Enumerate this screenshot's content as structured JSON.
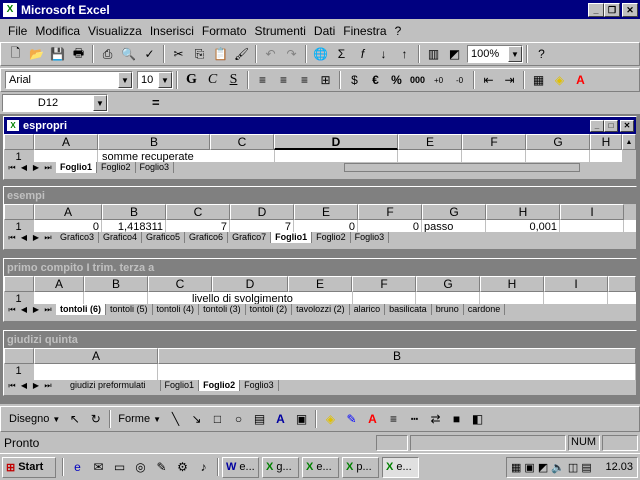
{
  "app": {
    "title": "Microsoft Excel"
  },
  "menu": [
    "File",
    "Modifica",
    "Visualizza",
    "Inserisci",
    "Formato",
    "Strumenti",
    "Dati",
    "Finestra",
    "?"
  ],
  "toolbar": {
    "zoom": "100%",
    "font": "Arial",
    "size": "10",
    "bold": "G",
    "italic": "C",
    "underline": "S",
    "currency": "€",
    "percent": "%",
    "thousands": "000"
  },
  "formula": {
    "namebox": "D12",
    "equals": "="
  },
  "workbooks": [
    {
      "title": "espropri",
      "cols": [
        "A",
        "B",
        "C",
        "D",
        "E",
        "F",
        "G",
        "H"
      ],
      "row": "1",
      "cells": [
        "",
        "somme recuperate",
        "",
        "",
        "",
        "",
        "",
        ""
      ],
      "tabs": [
        "Foglio1",
        "Foglio2",
        "Foglio3"
      ],
      "selected": 0
    },
    {
      "title": "esempi",
      "cols": [
        "A",
        "B",
        "C",
        "D",
        "E",
        "F",
        "G",
        "H",
        "I"
      ],
      "row": "1",
      "cells": [
        "0",
        "1,418311",
        "7",
        "7",
        "0",
        "0",
        "passo",
        "0,001",
        ""
      ],
      "tabs": [
        "Grafico3",
        "Grafico4",
        "Grafico5",
        "Grafico6",
        "Grafico7",
        "Foglio1",
        "Foglio2",
        "Foglio3"
      ],
      "selected": 5
    },
    {
      "title": "primo compito I trim. terza a",
      "cols": [
        "A",
        "B",
        "C",
        "D",
        "E",
        "F",
        "G",
        "H",
        "I"
      ],
      "row": "1",
      "cells": [
        "",
        "",
        "",
        "livello di svolgimento",
        "",
        "",
        "",
        "",
        ""
      ],
      "tabs": [
        "tontoli (6)",
        "tontoli (5)",
        "tontoli (4)",
        "tontoli (3)",
        "tontoli (2)",
        "tavolozzi (2)",
        "alarico",
        "basilicata",
        "bruno",
        "cardone"
      ],
      "selected": 0
    },
    {
      "title": "giudizi quinta",
      "cols": [
        "A",
        "B"
      ],
      "row": "1",
      "cells": [
        "",
        ""
      ],
      "tabs": [
        "giudizi preformulati",
        "Foglio1",
        "Foglio2",
        "Foglio3"
      ],
      "selected": 2
    }
  ],
  "drawing": {
    "draw": "Disegno",
    "shapes": "Forme"
  },
  "status": {
    "ready": "Pronto",
    "num": "NUM"
  },
  "taskbar": {
    "start": "Start",
    "tasks": [
      "e...",
      "g...",
      "e...",
      "p...",
      "e..."
    ],
    "clock": "12.03"
  }
}
